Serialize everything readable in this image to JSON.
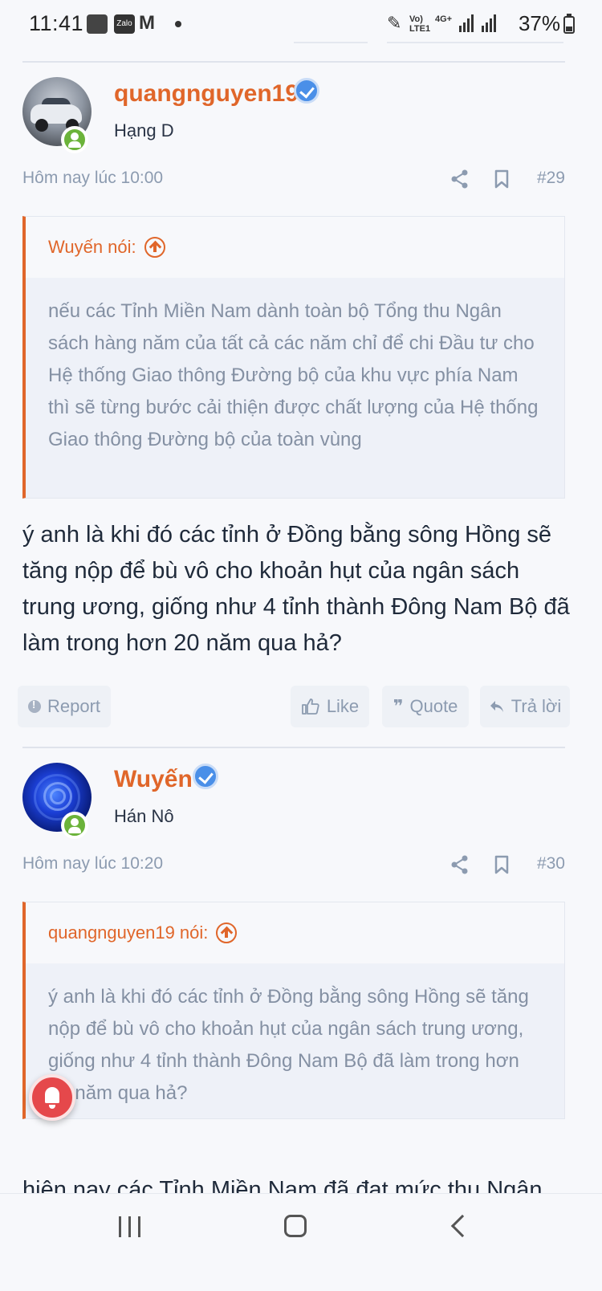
{
  "status_bar": {
    "time": "11:41",
    "right_text": "37%",
    "network_label": "Vo) LTE1",
    "network_type": "4G+"
  },
  "posts": [
    {
      "username": "quangnguyen19",
      "rank": "Hạng D",
      "timestamp": "Hôm nay lúc 10:00",
      "number": "#29",
      "quote_author": "Wuyến nói:",
      "quote_text": "nếu các Tỉnh Miền Nam dành toàn bộ Tổng thu Ngân sách hàng năm của tất cả các năm chỉ để chi Đầu tư cho Hệ thống Giao thông Đường bộ của khu vực phía Nam\nthì sẽ từng bước cải thiện được chất lượng của Hệ thống Giao thông Đường bộ của toàn vùng",
      "body": "ý anh là khi đó các tỉnh ở Đồng bằng sông Hồng sẽ tăng nộp để bù vô cho khoản hụt của ngân sách trung ương, giống như 4 tỉnh thành Đông Nam Bộ đã làm trong hơn 20 năm qua hả?"
    },
    {
      "username": "Wuyến",
      "rank": "Hán Nô",
      "timestamp": "Hôm nay lúc 10:20",
      "number": "#30",
      "quote_author": "quangnguyen19 nói:",
      "quote_text": "ý anh là khi đó các tỉnh ở Đồng bằng sông Hồng sẽ tăng nộp để bù vô cho khoản hụt của ngân sách trung ương, giống như 4 tỉnh thành Đông Nam Bộ đã làm trong hơn 20 năm qua hả?",
      "body_partial": "hiện nay các Tỉnh Miền Nam đã đạt mức thu Ngân"
    }
  ],
  "actions": {
    "report": "Report",
    "like": "Like",
    "quote": "Quote",
    "reply": "Trả lời"
  },
  "colors": {
    "accent": "#e0662a",
    "muted": "#8c9bb0",
    "verified": "#4a8fe8",
    "online": "#6bb33a",
    "notification": "#e5484b"
  }
}
